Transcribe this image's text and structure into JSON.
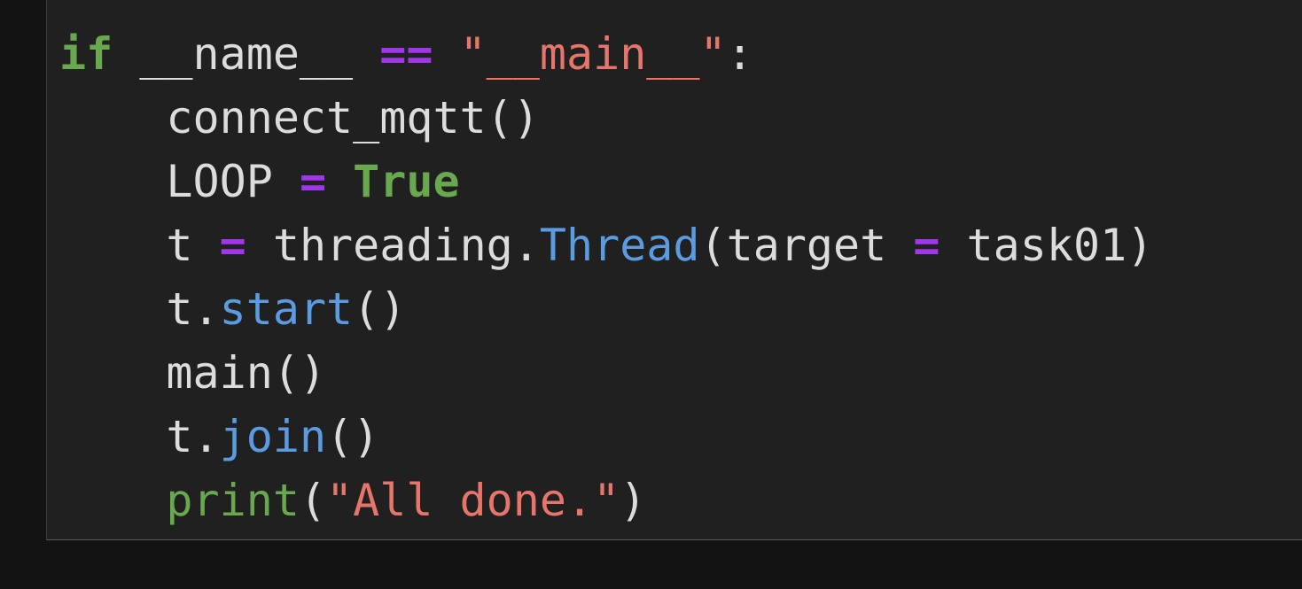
{
  "editor": {
    "language": "python",
    "colors": {
      "background": "#202020",
      "outer_background": "#131313",
      "default_text": "#dcdcdc",
      "keyword": "#6aa84f",
      "operator": "#a335ee",
      "string": "#e6756b",
      "method": "#5b9be0"
    },
    "lines": [
      {
        "indent": 0,
        "tokens": [
          {
            "text": "if",
            "type": "keyword",
            "bold": true
          },
          {
            "text": " __name__ ",
            "type": "plain"
          },
          {
            "text": "==",
            "type": "operator",
            "bold": true
          },
          {
            "text": " ",
            "type": "plain"
          },
          {
            "text": "\"__main__\"",
            "type": "string"
          },
          {
            "text": ":",
            "type": "plain"
          }
        ]
      },
      {
        "indent": 1,
        "tokens": [
          {
            "text": "connect_mqtt()",
            "type": "plain"
          }
        ]
      },
      {
        "indent": 1,
        "tokens": [
          {
            "text": "LOOP ",
            "type": "plain"
          },
          {
            "text": "=",
            "type": "operator",
            "bold": true
          },
          {
            "text": " ",
            "type": "plain"
          },
          {
            "text": "True",
            "type": "keyword",
            "bold": true
          }
        ]
      },
      {
        "indent": 1,
        "tokens": [
          {
            "text": "t ",
            "type": "plain"
          },
          {
            "text": "=",
            "type": "operator",
            "bold": true
          },
          {
            "text": " threading.",
            "type": "plain"
          },
          {
            "text": "Thread",
            "type": "method"
          },
          {
            "text": "(target ",
            "type": "plain"
          },
          {
            "text": "=",
            "type": "operator",
            "bold": true
          },
          {
            "text": " task01)",
            "type": "plain"
          }
        ]
      },
      {
        "indent": 1,
        "tokens": [
          {
            "text": "t.",
            "type": "plain"
          },
          {
            "text": "start",
            "type": "method"
          },
          {
            "text": "()",
            "type": "plain"
          }
        ]
      },
      {
        "indent": 1,
        "tokens": [
          {
            "text": "main()",
            "type": "plain"
          }
        ]
      },
      {
        "indent": 1,
        "tokens": [
          {
            "text": "t.",
            "type": "plain"
          },
          {
            "text": "join",
            "type": "method"
          },
          {
            "text": "()",
            "type": "plain"
          }
        ]
      },
      {
        "indent": 1,
        "tokens": [
          {
            "text": "print",
            "type": "keyword"
          },
          {
            "text": "(",
            "type": "plain"
          },
          {
            "text": "\"All done.\"",
            "type": "string"
          },
          {
            "text": ")",
            "type": "plain"
          }
        ]
      }
    ]
  }
}
